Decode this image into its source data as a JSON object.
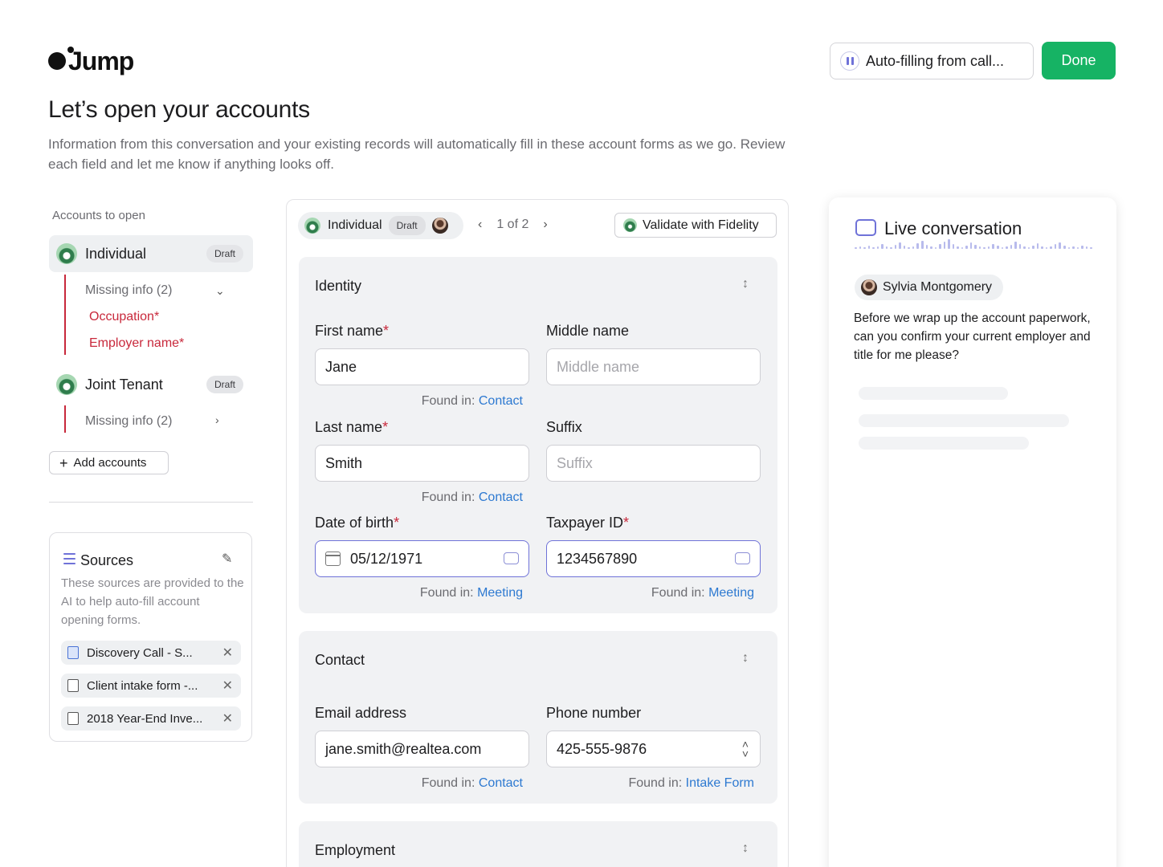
{
  "header": {
    "logo_text": "Jump",
    "autofill_label": "Auto-filling from call...",
    "done_label": "Done",
    "title": "Let’s open your accounts",
    "description": "Information from this conversation and your existing records will automatically fill in these account forms as we go. Review each field and let me know if anything looks off."
  },
  "sidebar": {
    "heading": "Accounts to open",
    "accounts": [
      {
        "name": "Individual",
        "badge": "Draft",
        "missing_label": "Missing info (2)",
        "missing_fields": [
          "Occupation*",
          "Employer name*"
        ]
      },
      {
        "name": "Joint Tenant",
        "badge": "Draft",
        "missing_label": "Missing info (2)"
      }
    ],
    "add_label": "Add accounts",
    "sources": {
      "title": "Sources",
      "description": "These sources are provided to the AI to help auto-fill account opening forms.",
      "items": [
        "Discovery Call - S...",
        "Client intake form -...",
        "2018 Year-End Inve..."
      ]
    }
  },
  "form": {
    "tab_label": "Individual",
    "tab_badge": "Draft",
    "pager": "1 of 2",
    "validate_label": "Validate with Fidelity",
    "found_prefix": "Found in:",
    "sections": {
      "identity": {
        "title": "Identity",
        "first_name": {
          "label": "First name",
          "value": "Jane",
          "source": "Contact"
        },
        "middle_name": {
          "label": "Middle name",
          "placeholder": "Middle name"
        },
        "last_name": {
          "label": "Last name",
          "value": "Smith",
          "source": "Contact"
        },
        "suffix": {
          "label": "Suffix",
          "placeholder": "Suffix"
        },
        "dob": {
          "label": "Date of birth",
          "value": "05/12/1971",
          "source": "Meeting"
        },
        "taxpayer": {
          "label": "Taxpayer ID",
          "value": "1234567890",
          "source": "Meeting"
        }
      },
      "contact": {
        "title": "Contact",
        "email": {
          "label": "Email address",
          "value": "jane.smith@realtea.com",
          "source": "Contact"
        },
        "phone": {
          "label": "Phone number",
          "value": "425-555-9876",
          "source": "Intake Form"
        }
      },
      "employment": {
        "title": "Employment"
      }
    }
  },
  "live": {
    "title": "Live conversation",
    "speaker": "Sylvia Montgomery",
    "message": "Before we wrap up the account paperwork, can you confirm your current employer and title for me please?"
  },
  "colors": {
    "accent": "#6f72d8",
    "done_green": "#16b364",
    "required_red": "#c8283b",
    "link_blue": "#2d79d1"
  }
}
